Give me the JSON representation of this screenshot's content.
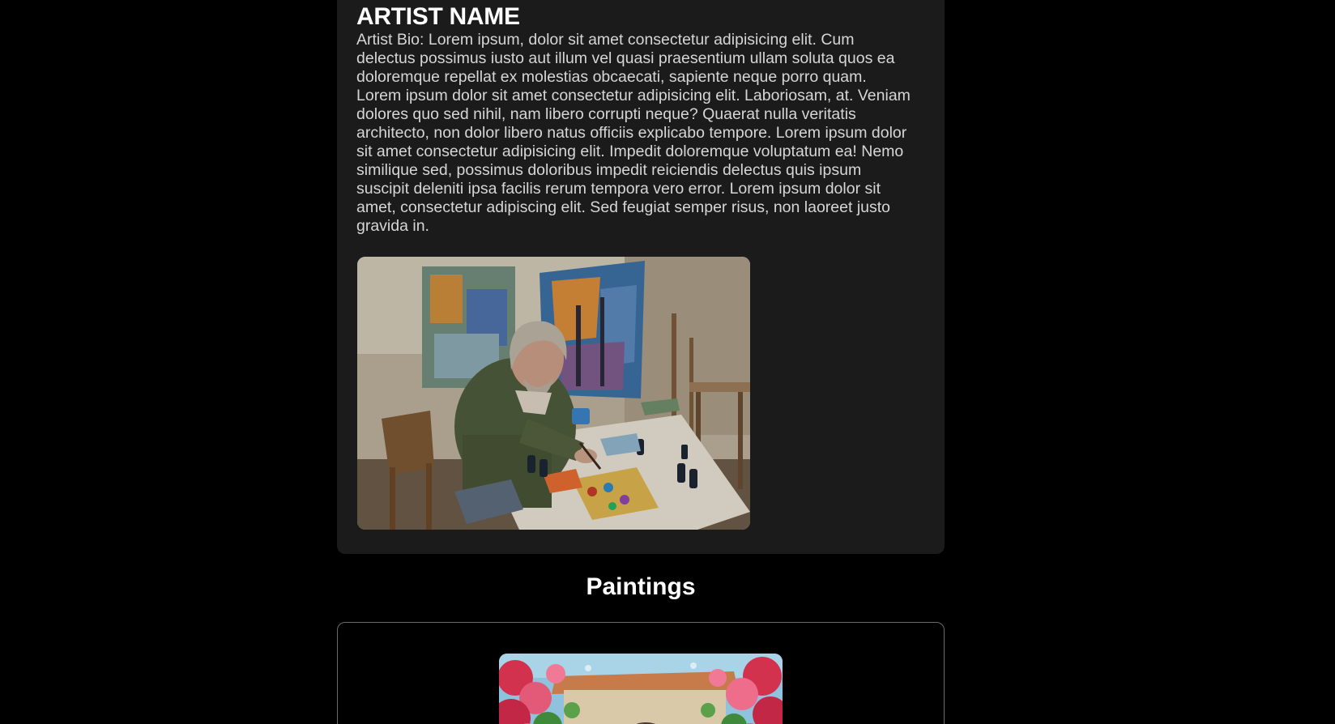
{
  "artist": {
    "name": "ARTIST NAME",
    "bio": "Artist Bio: Lorem ipsum, dolor sit amet consectetur adipisicing elit. Cum delectus possimus iusto aut illum vel quasi praesentium ullam soluta quos ea doloremque repellat ex molestias obcaecati, sapiente neque porro quam. Lorem ipsum dolor sit amet consectetur adipisicing elit. Laboriosam, at. Veniam dolores quo sed nihil, nam libero corrupti neque? Quaerat nulla veritatis architecto, non dolor libero natus officiis explicabo tempore. Lorem ipsum dolor sit amet consectetur adipisicing elit. Impedit doloremque voluptatum ea! Nemo similique sed, possimus doloribus impedit reiciendis delectus quis ipsum suscipit deleniti ipsa facilis rerum tempora vero error. Lorem ipsum dolor sit amet, consectetur adipiscing elit. Sed feugiat semper risus, non laoreet justo gravida in."
  },
  "paintings": {
    "title": "Paintings"
  },
  "colors": {
    "page_background": "#000000",
    "card_background": "#1b1b1b",
    "text_primary": "#ffffff",
    "text_body": "#d6d6d6",
    "card_border": "#6b6b6b"
  }
}
